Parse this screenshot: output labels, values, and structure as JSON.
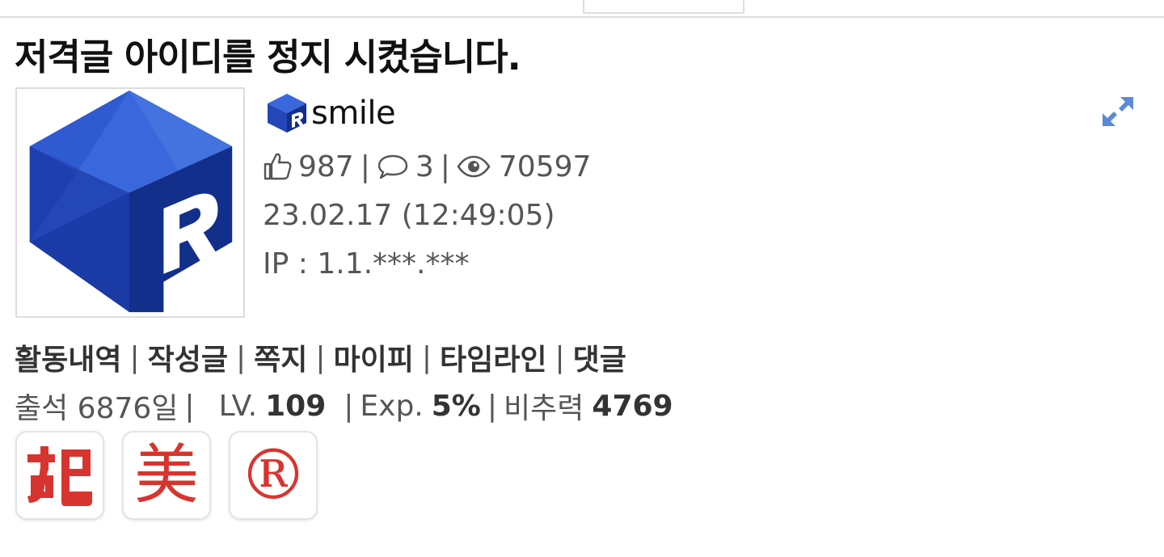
{
  "post": {
    "title": "저격글 아이디를 정지 시켰습니다."
  },
  "author": {
    "nickname": "smile",
    "likes": "987",
    "comments": "3",
    "views": "70597",
    "date": "23.02.17 (12:49:05)",
    "ip": "IP : 1.1.***.***"
  },
  "separator": "|",
  "links": [
    "활동내역",
    "작성글",
    "쪽지",
    "마이피",
    "타임라인",
    "댓글"
  ],
  "stats": {
    "attendance_label": "출석 6876일",
    "lv_label": "LV.",
    "lv_value": "109",
    "exp_label": "Exp.",
    "exp_value": "5%",
    "noncommend_label": "비추력",
    "noncommend_value": "4769"
  },
  "badges": [
    "加+巴 ligature",
    "美",
    "®"
  ],
  "colors": {
    "badge_red": "#d8342f",
    "avatar_blue": "#2a4fc6",
    "expand_icon": "#5b8ad6"
  },
  "icons": [
    "thumbs-up-icon",
    "comment-icon",
    "eye-icon",
    "expand-icon",
    "avatar-r-cube-icon"
  ]
}
